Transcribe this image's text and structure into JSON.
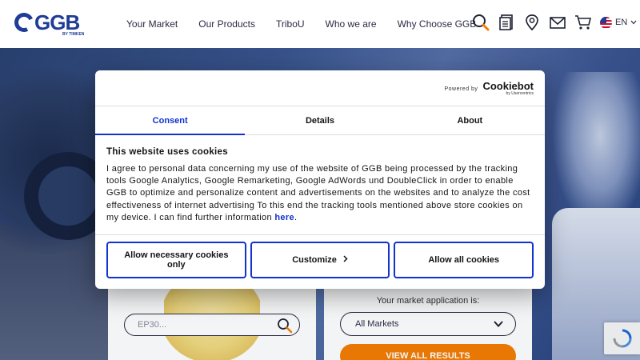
{
  "header": {
    "logo_text": "GGB",
    "logo_sub": "BY TIMKEN",
    "nav": [
      "Your Market",
      "Our Products",
      "TriboU",
      "Who we are",
      "Why Choose GGB"
    ],
    "language": "EN"
  },
  "search_panel": {
    "search_placeholder": "EP30...",
    "market_label": "Your market application is:",
    "market_selected": "All Markets",
    "view_all_label": "VIEW ALL RESULTS"
  },
  "cookie_dialog": {
    "powered_by": "Powered by",
    "cookiebot_brand": "Cookiebot",
    "cookiebot_sub": "by Usercentrics",
    "tabs": [
      {
        "label": "Consent"
      },
      {
        "label": "Details"
      },
      {
        "label": "About"
      }
    ],
    "title": "This website uses cookies",
    "text": "I agree to personal data concerning my use of the website of GGB being processed by the tracking tools Google Analytics, Google Remarketing, Google AdWords und DoubleClick in order to enable GGB to optimize and personalize content and advertisements on the websites and to analyze the cost effectiveness of internet advertising To this end the tracking tools mentioned above store cookies on my device. I can find further information",
    "link_text": "here",
    "buttons": {
      "necessary": "Allow necessary cookies only",
      "customize": "Customize",
      "allow_all": "Allow all cookies"
    }
  },
  "colors": {
    "brand_blue": "#1f3c96",
    "cookiebot_blue": "#1032cf",
    "orange": "#f57c00"
  }
}
